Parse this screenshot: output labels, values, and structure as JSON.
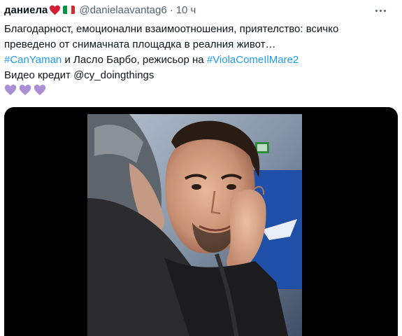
{
  "author": {
    "name": "даниела",
    "handle": "@danielaavantag6",
    "separator": "·",
    "time": "10 ч",
    "heart_icon": "red-heart-icon",
    "flag_icon": "italy-flag-icon",
    "flag_colors": [
      "#009246",
      "#ffffff",
      "#ce2b37"
    ]
  },
  "tweet": {
    "line1": "Благодарност, емоционални взаимоотношения, приятелство: всичко",
    "line2": "преведено от снимачната площадка в реалния живот…",
    "hashtag1": "#CanYaman",
    "line3_middle": " и Ласло Барбо, режисьор на ",
    "hashtag2": "#ViolaComeIlMare2",
    "line4": "Видео кредит @cy_doingthings",
    "emoji": [
      "purple-heart-icon",
      "purple-heart-icon",
      "purple-heart-icon"
    ]
  },
  "media": {
    "type": "video",
    "icon": "video-thumbnail"
  },
  "colors": {
    "text": "#0f1419",
    "secondary": "#536471",
    "link": "#1d9bf0",
    "heart": "#d41e35",
    "purple": "#aa8ed6"
  }
}
